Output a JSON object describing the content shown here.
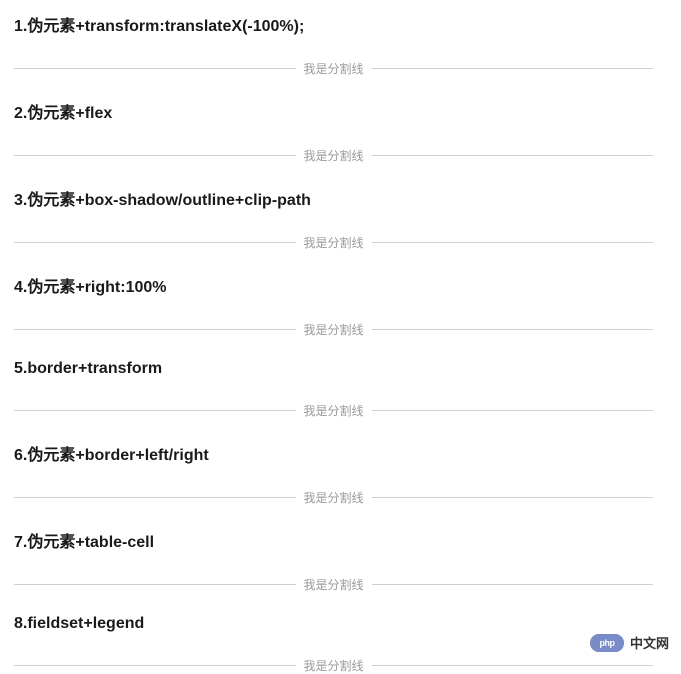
{
  "divider_label": "我是分割线",
  "items": [
    {
      "heading": "1.伪元素+transform:translateX(-100%);"
    },
    {
      "heading": "2.伪元素+flex"
    },
    {
      "heading": "3.伪元素+box-shadow/outline+clip-path"
    },
    {
      "heading": "4.伪元素+right:100%"
    },
    {
      "heading": "5.border+transform"
    },
    {
      "heading": "6.伪元素+border+left/right"
    },
    {
      "heading": "7.伪元素+table-cell"
    },
    {
      "heading": "8.fieldset+legend"
    }
  ],
  "watermark": {
    "logo_text": "php",
    "site_text": "中文网"
  }
}
